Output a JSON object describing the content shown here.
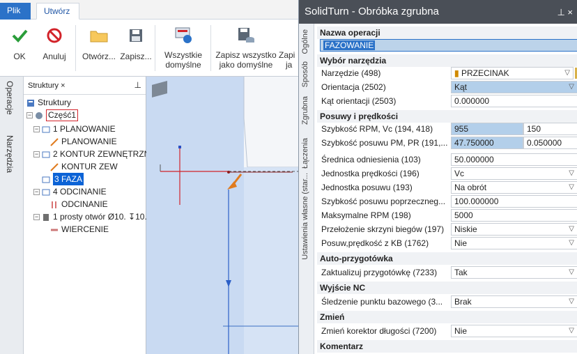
{
  "ribbon": {
    "tabs": [
      {
        "label": "Plik"
      },
      {
        "label": "Utwórz"
      }
    ],
    "buttons": {
      "ok": "OK",
      "cancel": "Anuluj",
      "open": "Otwórz...",
      "save": "Zapisz...",
      "all_default_1": "Wszystkie",
      "all_default_2": "domyślne",
      "save_all_1": "Zapisz wszystko",
      "save_all_2": "jako domyślne",
      "cut_1": "Zapi",
      "cut_2": "ja"
    }
  },
  "left_tabs": {
    "operations": "Operacje",
    "tools": "Narzędzia"
  },
  "structure": {
    "tab": "Struktury",
    "close": "×",
    "pin": "⊥",
    "items": [
      {
        "label": "Struktury"
      },
      {
        "label": "Część1"
      },
      {
        "label": "1 PLANOWANIE"
      },
      {
        "label": "PLANOWANIE"
      },
      {
        "label": "2 KONTUR ZEWNĘTRZNY"
      },
      {
        "label": "KONTUR ZEW"
      },
      {
        "label": "3 FAZA"
      },
      {
        "label": "4 ODCINANIE"
      },
      {
        "label": "ODCINANIE"
      },
      {
        "label": "1 prosty otwór Ø10. ↧10."
      },
      {
        "label": "WIERCENIE"
      }
    ]
  },
  "dialog": {
    "title": "SolidTurn - Obróbka zgrubna",
    "controls": "⊥  ×",
    "vtabs": [
      "Ogólne",
      "Sposób",
      "Zgrubna",
      "Łączenia",
      "Ustawienia własne (star..."
    ],
    "sections": {
      "op_name": "Nazwa operacji",
      "tool": "Wybór narzędzia",
      "feeds": "Posuwy i prędkości",
      "auto": "Auto-przygotówka",
      "nc": "Wyjście NC",
      "change": "Zmień",
      "comment": "Komentarz"
    },
    "op_name_value": "FAZOWANIE",
    "props": [
      {
        "label": "Narzędzie (498)",
        "value": "PRZECINAK"
      },
      {
        "label": "Orientacja (2502)",
        "value": "Kąt"
      },
      {
        "label": "Kąt orientacji (2503)",
        "value": "0.000000"
      },
      {
        "label": "Szybkość RPM, Vc (194, 418)",
        "value": "955",
        "value2": "150"
      },
      {
        "label": "Szybkość posuwu PM, PR (191,...",
        "value": "47.750000",
        "value2": "0.050000"
      },
      {
        "label": "Średnica odniesienia (103)",
        "value": "50.000000"
      },
      {
        "label": "Jednostka prędkości (196)",
        "value": "Vc"
      },
      {
        "label": "Jednostka posuwu (193)",
        "value": "Na obrót"
      },
      {
        "label": "Szybkość posuwu poprzeczneg...",
        "value": "100.000000"
      },
      {
        "label": "Maksymalne RPM (198)",
        "value": "5000"
      },
      {
        "label": "Przełożenie skrzyni biegów (197)",
        "value": "Niskie"
      },
      {
        "label": "Posuw,prędkość z KB (1762)",
        "value": "Nie"
      },
      {
        "label": "Zaktualizuj przygotówkę (7233)",
        "value": "Tak"
      },
      {
        "label": "Śledzenie punktu bazowego  (3...",
        "value": "Brak"
      },
      {
        "label": "Zmień korektor długości (7200)",
        "value": "Nie"
      }
    ]
  },
  "colors": {
    "accent": "#2b72c8",
    "title_bar": "#4a4f57",
    "viewport": "#c9daf2",
    "selected": "#0c63d6"
  }
}
